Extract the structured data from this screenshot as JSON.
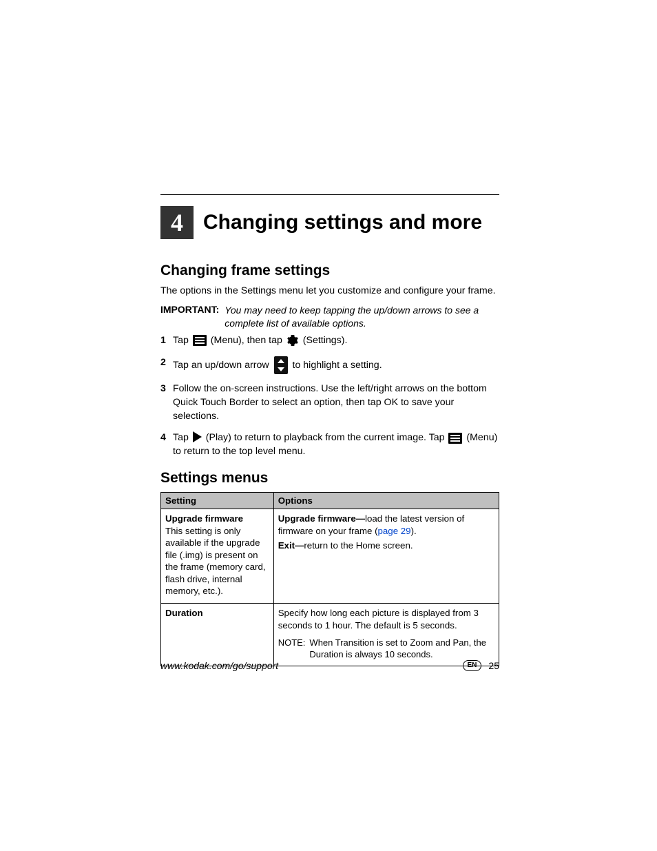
{
  "chapter": {
    "number": "4",
    "title": "Changing settings and more"
  },
  "section1": {
    "heading": "Changing frame settings",
    "intro": "The options in the Settings menu let you customize and configure your frame.",
    "important_label": "IMPORTANT:",
    "important_text": "You may need to keep tapping the up/down arrows to see a complete list of available options."
  },
  "steps": {
    "s1a": "Tap ",
    "s1b": " (Menu), then tap ",
    "s1c": " (Settings).",
    "s2a": "Tap an up/down arrow ",
    "s2b": " to highlight a setting.",
    "s3": "Follow the on-screen instructions. Use the left/right arrows on the bottom Quick Touch Border to select an option, then tap OK to save your selections.",
    "s4a": "Tap ",
    "s4b": " (Play) to return to playback from the current image. Tap ",
    "s4c": " (Menu) to return to the top level menu."
  },
  "section2": {
    "heading": "Settings menus"
  },
  "table": {
    "headers": {
      "setting": "Setting",
      "options": "Options"
    },
    "rows": [
      {
        "setting_title": "Upgrade firmware",
        "setting_desc": "This setting is only available if the upgrade file (.img) is present on the frame (memory card, flash drive, internal memory, etc.).",
        "opt1_bold": "Upgrade firmware—",
        "opt1_rest_a": "load the latest version of firmware on your frame (",
        "opt1_link": "page 29",
        "opt1_rest_b": ").",
        "opt2_bold": "Exit—",
        "opt2_rest": "return to the Home screen."
      },
      {
        "setting_title": "Duration",
        "setting_desc": "",
        "opt_main": "Specify how long each picture is displayed from 3 seconds to 1 hour. The default is 5 seconds.",
        "note_label": "NOTE:",
        "note_text": "When Transition is set to Zoom and Pan, the Duration is always 10 seconds."
      }
    ]
  },
  "footer": {
    "url": "www.kodak.com/go/support",
    "lang": "EN",
    "page": "25"
  }
}
